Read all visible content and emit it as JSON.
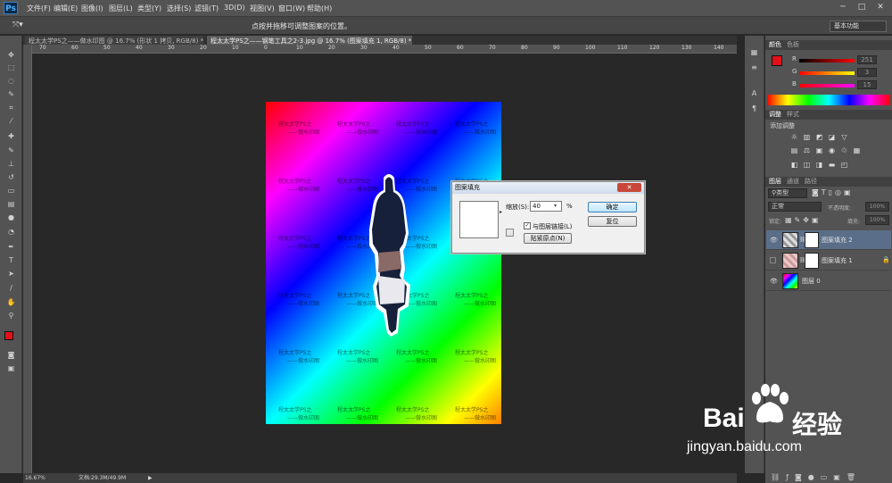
{
  "app": {
    "logo": "Ps"
  },
  "menu": [
    "文件(F)",
    "编辑(E)",
    "图像(I)",
    "图层(L)",
    "类型(Y)",
    "选择(S)",
    "滤镜(T)",
    "3D(D)",
    "视图(V)",
    "窗口(W)",
    "帮助(H)"
  ],
  "window_controls": [
    "─",
    "□",
    "✕"
  ],
  "options_bar": {
    "hint": "点按并拖移可调整图案的位置。",
    "workspace": "基本功能"
  },
  "tabs": [
    {
      "label": "程太太学PS之——做水印图 @ 16.7% (形状 1 拷贝, RGB/8) *",
      "active": false
    },
    {
      "label": "程太太学PS之——钢笔工具之2-3.jpg @ 16.7% (图案填充 1, RGB/8) *",
      "active": true
    }
  ],
  "ruler_ticks": [
    "70",
    "60",
    "50",
    "40",
    "30",
    "20",
    "10",
    "0",
    "10",
    "20",
    "30",
    "40",
    "50",
    "60",
    "70",
    "80",
    "90",
    "100",
    "110",
    "120",
    "130",
    "140"
  ],
  "watermark": {
    "line1": "程太太学PS之",
    "line2": "——做水印图"
  },
  "status": {
    "zoom": "16.67%",
    "doc": "文档:29.3M/49.9M"
  },
  "dialog": {
    "title": "图案填充",
    "scale_label": "缩放(S):",
    "scale_value": "40",
    "percent": "%",
    "link_label": "与图层链接(L)",
    "snap_label": "贴紧原点(N)",
    "ok": "确定",
    "reset": "复位"
  },
  "color_panel": {
    "tabs": [
      "颜色",
      "色板"
    ],
    "channels": [
      {
        "name": "R",
        "value": "251"
      },
      {
        "name": "G",
        "value": "3"
      },
      {
        "name": "B",
        "value": "15"
      }
    ]
  },
  "adjust_panel": {
    "tabs": [
      "调整",
      "样式"
    ],
    "title": "添加调整"
  },
  "layers_panel": {
    "tabs": [
      "图层",
      "通道",
      "路径"
    ],
    "filter": "类型",
    "blend": "正常",
    "opacity_label": "不透明度:",
    "opacity": "100%",
    "lock_label": "锁定:",
    "fill_label": "填充:",
    "fill": "100%",
    "layers": [
      {
        "name": "图案填充 2",
        "visible": true,
        "selected": true
      },
      {
        "name": "图案填充 1",
        "visible": false,
        "selected": false
      },
      {
        "name": "图层 0",
        "visible": true,
        "selected": false
      }
    ]
  },
  "baidu": {
    "brand": "Bai",
    "brand2": "经验",
    "url": "jingyan.baidu.com"
  },
  "colors": {
    "foreground": "#e3101a",
    "background": "#ffffff",
    "accent": "#2b6fbf"
  }
}
